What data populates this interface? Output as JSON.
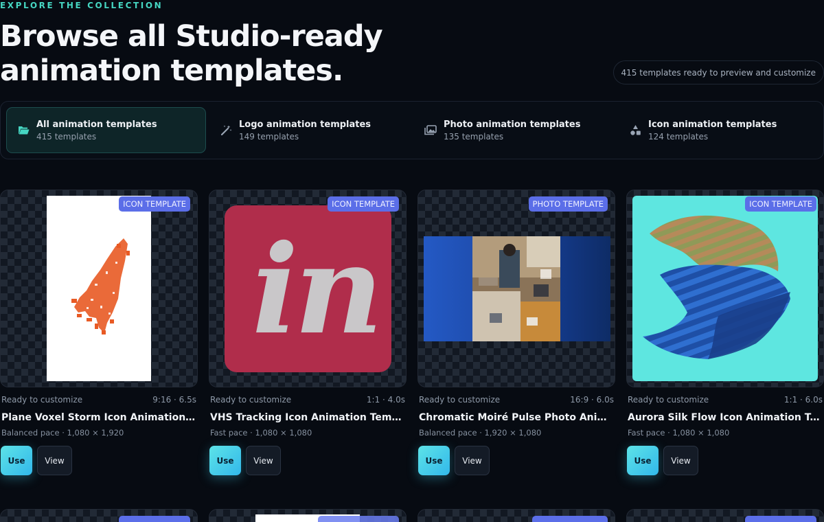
{
  "header": {
    "eyebrow": "EXPLORE THE COLLECTION",
    "title_line1": "Browse all Studio-ready",
    "title_line2": "animation templates.",
    "count_pill": "415 templates ready to preview and customize"
  },
  "tabs": [
    {
      "label": "All animation templates",
      "count": "415 templates",
      "icon": "folder-open-icon",
      "active": true
    },
    {
      "label": "Logo animation templates",
      "count": "149 templates",
      "icon": "magic-wand-icon",
      "active": false
    },
    {
      "label": "Photo animation templates",
      "count": "135 templates",
      "icon": "photos-icon",
      "active": false
    },
    {
      "label": "Icon animation templates",
      "count": "124 templates",
      "icon": "shapes-icon",
      "active": false
    }
  ],
  "cards": [
    {
      "badge": "ICON TEMPLATE",
      "status": "Ready to customize",
      "specs": "9:16 · 6.5s",
      "title": "Plane Voxel Storm Icon Animation Template",
      "sub": "Balanced pace · 1,080 × 1,920",
      "use_label": "Use",
      "view_label": "View"
    },
    {
      "badge": "ICON TEMPLATE",
      "status": "Ready to customize",
      "specs": "1:1 · 4.0s",
      "title": "VHS Tracking Icon Animation Template",
      "sub": "Fast pace · 1,080 × 1,080",
      "use_label": "Use",
      "view_label": "View",
      "logo_text": "in"
    },
    {
      "badge": "PHOTO TEMPLATE",
      "status": "Ready to customize",
      "specs": "16:9 · 6.0s",
      "title": "Chromatic Moiré Pulse Photo Animation Template",
      "sub": "Balanced pace · 1,920 × 1,080",
      "use_label": "Use",
      "view_label": "View"
    },
    {
      "badge": "ICON TEMPLATE",
      "status": "Ready to customize",
      "specs": "1:1 · 6.0s",
      "title": "Aurora Silk Flow Icon Animation Template",
      "sub": "Fast pace · 1,080 × 1,080",
      "use_label": "Use",
      "view_label": "View"
    }
  ],
  "colors": {
    "accent": "#46d6c2",
    "badge": "#5b6ee8",
    "background": "#070b12"
  }
}
